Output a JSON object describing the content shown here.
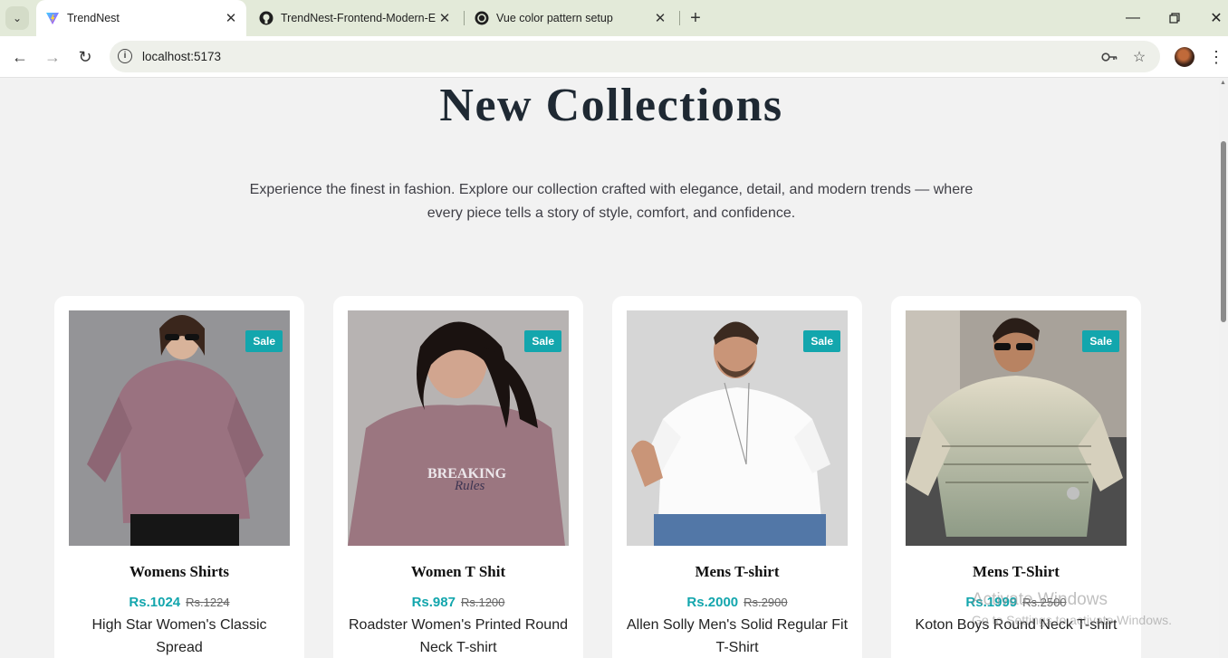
{
  "browser": {
    "tabs": [
      {
        "title": "TrendNest",
        "favicon": "vite-icon",
        "active": true
      },
      {
        "title": "TrendNest-Frontend-Modern-E",
        "favicon": "github-icon",
        "active": false
      },
      {
        "title": "Vue color pattern setup",
        "favicon": "chatgpt-icon",
        "active": false
      }
    ],
    "url": "localhost:5173"
  },
  "page": {
    "heading": "New Collections",
    "subtitle": "Experience the finest in fashion. Explore our collection crafted with elegance, detail, and modern trends — where every piece tells a story of style, comfort, and confidence.",
    "products": [
      {
        "badge": "Sale",
        "name": "Womens Shirts",
        "price": "Rs.1024",
        "old_price": "Rs.1224",
        "description": "High Star Women's Classic Spread"
      },
      {
        "badge": "Sale",
        "name": "Women T Shit",
        "price": "Rs.987",
        "old_price": "Rs.1200",
        "description": "Roadster Women's Printed Round Neck T-shirt"
      },
      {
        "badge": "Sale",
        "name": "Mens T-shirt",
        "price": "Rs.2000",
        "old_price": "Rs.2900",
        "description": "Allen Solly Men's Solid Regular Fit T-Shirt"
      },
      {
        "badge": "Sale",
        "name": "Mens T-Shirt",
        "price": "Rs.1999",
        "old_price": "Rs.2500",
        "description": "Koton Boys Round Neck T-shirt"
      }
    ]
  },
  "watermark": {
    "line1": "Activate Windows",
    "line2": "Go to Settings to activate Windows."
  },
  "colors": {
    "accent": "#13a6ad",
    "tabstrip": "#e3ead9",
    "page_bg": "#f2f2f2"
  }
}
